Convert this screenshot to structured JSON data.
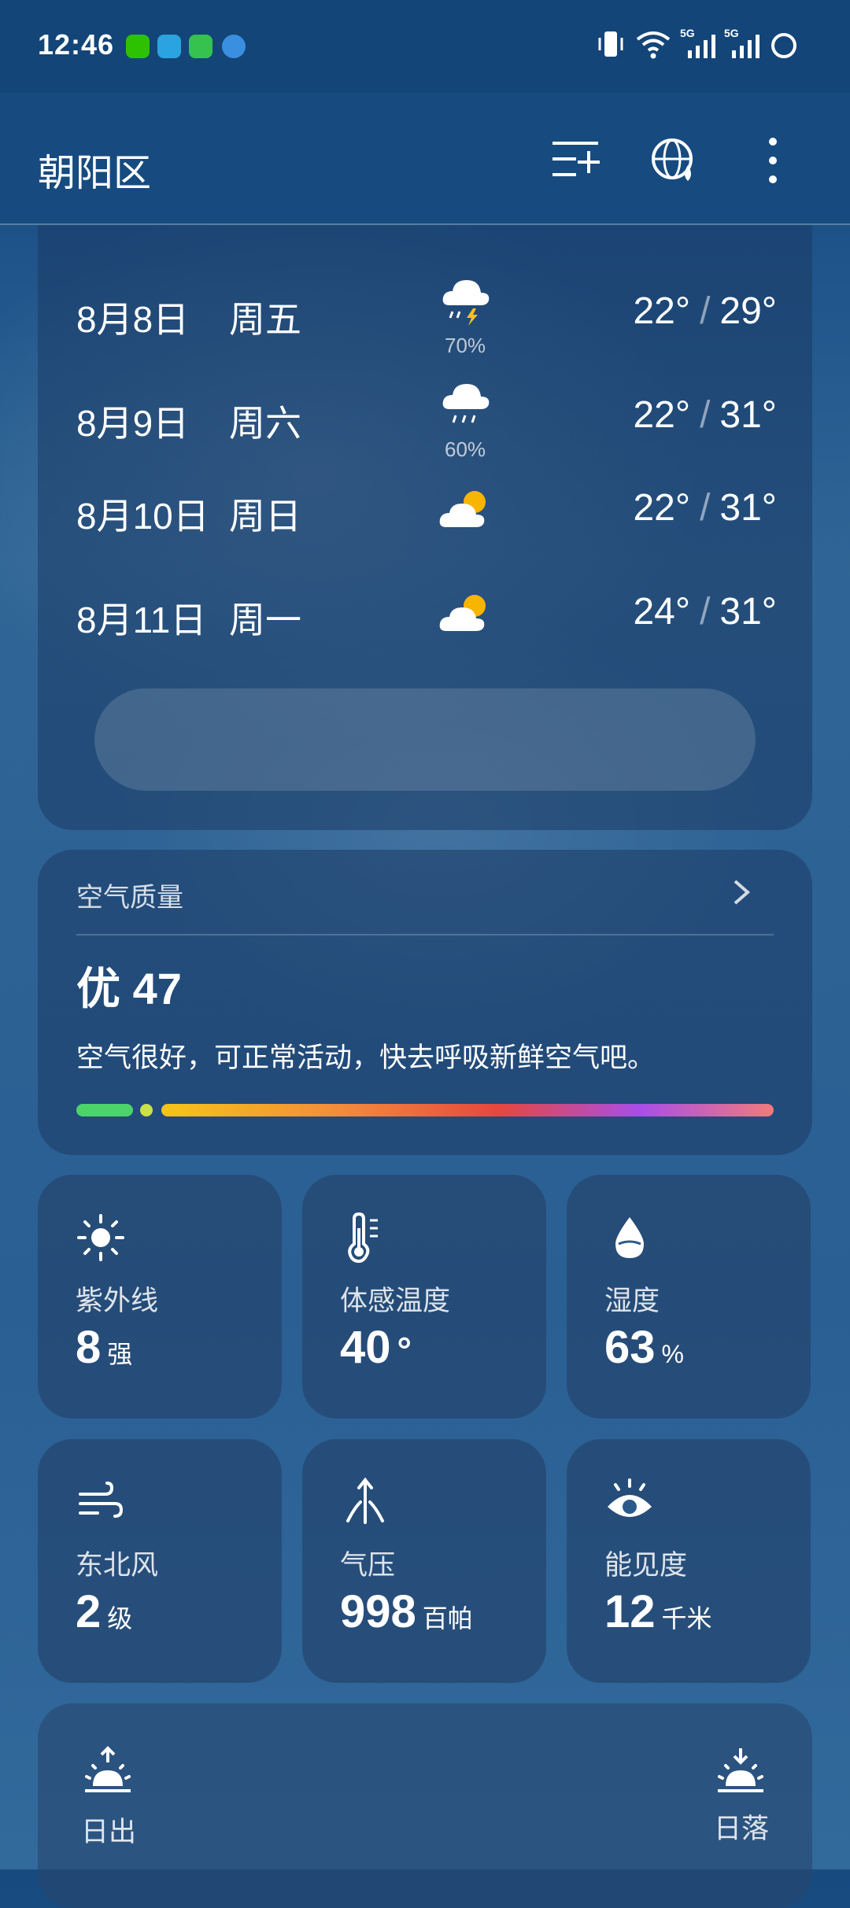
{
  "status_bar": {
    "time": "12:46",
    "notification_icons": [
      "wechat-icon",
      "telegram-icon",
      "message-icon",
      "app-icon"
    ],
    "signal_labels": [
      "5G",
      "5G"
    ]
  },
  "header": {
    "city": "朝阳区",
    "icons": [
      "add-city-icon",
      "globe-icon",
      "more-icon"
    ]
  },
  "forecast": {
    "rows": [
      {
        "date": "8月8日",
        "weekday": "周五",
        "icon": "thunderstorm-icon",
        "precip": "70%",
        "low": "22°",
        "high": "29°"
      },
      {
        "date": "8月9日",
        "weekday": "周六",
        "icon": "rain-icon",
        "precip": "60%",
        "low": "22°",
        "high": "31°"
      },
      {
        "date": "8月10日",
        "weekday": "周日",
        "icon": "partly-cloudy-icon",
        "precip": "",
        "low": "22°",
        "high": "31°"
      },
      {
        "date": "8月11日",
        "weekday": "周一",
        "icon": "partly-cloudy-icon",
        "precip": "",
        "low": "24°",
        "high": "31°"
      }
    ]
  },
  "air_quality": {
    "title": "空气质量",
    "level": "优",
    "aqi": "47",
    "description": "空气很好，可正常活动，快去呼吸新鲜空气吧。",
    "scale_colors": [
      "#4cd46a",
      "#c9e04a",
      "#f5c518",
      "#f38a3c",
      "#e6473e",
      "#a84ee8",
      "#f07b7b"
    ]
  },
  "details": [
    {
      "icon": "sun-icon",
      "label": "紫外线",
      "value": "8",
      "unit": "强"
    },
    {
      "icon": "thermometer-icon",
      "label": "体感温度",
      "value": "40",
      "unit": "°"
    },
    {
      "icon": "humidity-drop-icon",
      "label": "湿度",
      "value": "63",
      "unit": "%"
    },
    {
      "icon": "wind-icon",
      "label": "东北风",
      "value": "2",
      "unit": "级"
    },
    {
      "icon": "pressure-icon",
      "label": "气压",
      "value": "998",
      "unit": "百帕"
    },
    {
      "icon": "visibility-eye-icon",
      "label": "能见度",
      "value": "12",
      "unit": "千米"
    }
  ],
  "sun": {
    "sunrise_label": "日出",
    "sunset_label": "日落"
  }
}
